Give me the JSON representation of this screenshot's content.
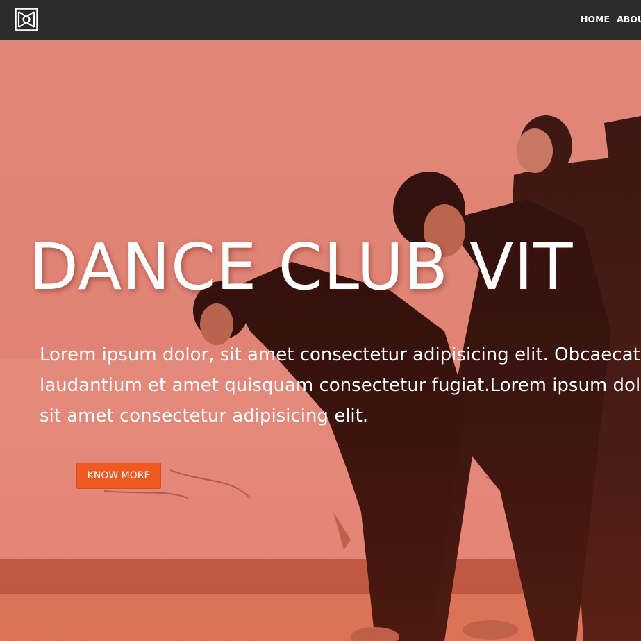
{
  "nav": {
    "logo_icon": "dance-club-logo",
    "links": [
      "HOME",
      "ABOUT"
    ]
  },
  "hero": {
    "title": "DANCE CLUB VIT",
    "paragraph_lines": [
      "Lorem ipsum dolor, sit amet consectetur adipisicing elit. Obcaecat",
      "laudantium et amet quisquam consectetur fugiat.Lorem ipsum dol",
      "sit amet consectetur adipisicing elit."
    ],
    "cta_label": "KNOW MORE"
  },
  "colors": {
    "navbar": "#2c2c2c",
    "hero_tint": "#e0847a",
    "cta": "#f05a22",
    "text": "#ffffff"
  }
}
